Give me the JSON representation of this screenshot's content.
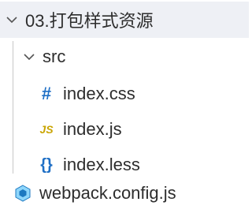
{
  "tree": {
    "root_folder": {
      "label": "03.打包样式资源",
      "icon": "chevron-down-icon"
    },
    "src_folder": {
      "label": "src",
      "icon": "chevron-down-icon"
    },
    "files": [
      {
        "label": "index.css",
        "icon_glyph": "#",
        "icon": "css-file-icon"
      },
      {
        "label": "index.js",
        "icon_glyph": "JS",
        "icon": "js-file-icon"
      },
      {
        "label": "index.less",
        "icon_glyph": "{}",
        "icon": "less-file-icon"
      }
    ],
    "config_file": {
      "label": "webpack.config.js",
      "icon": "webpack-icon"
    }
  },
  "colors": {
    "selected_row_bg": "#eef0f5",
    "css_icon": "#1f6fc5",
    "js_icon": "#c9a400",
    "less_icon": "#1f6fc5",
    "webpack_icon": "#1f6fc5"
  }
}
